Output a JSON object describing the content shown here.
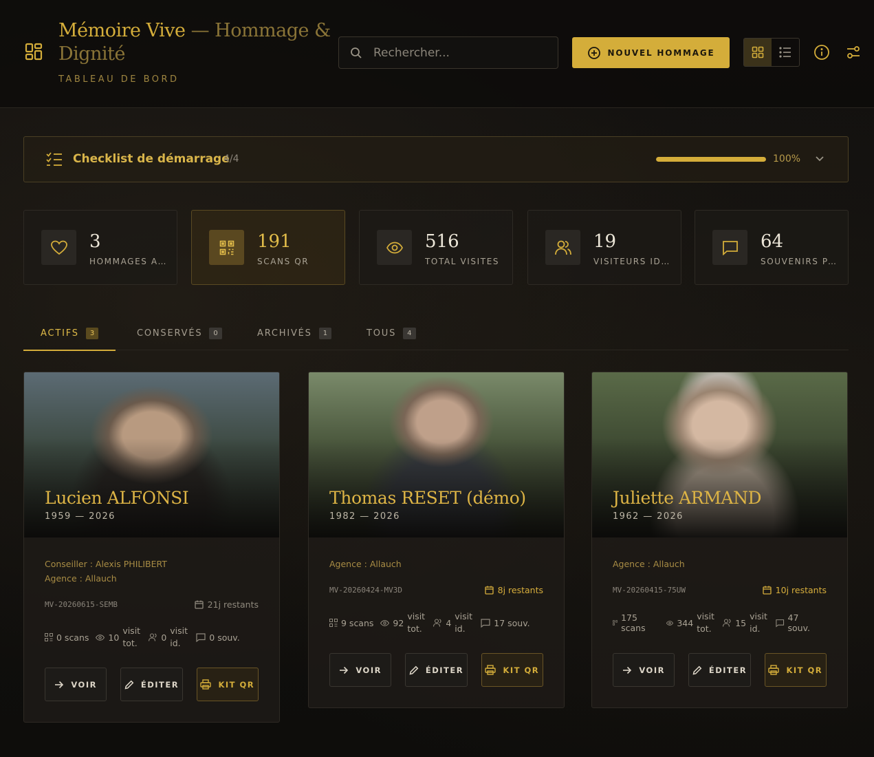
{
  "header": {
    "title_main": "Mémoire Vive",
    "title_rest": " — Hommage & Dignité",
    "subtitle": "TABLEAU DE BORD",
    "search_placeholder": "Rechercher...",
    "new_button_label": "NOUVEL HOMMAGE",
    "view_mode": "grid"
  },
  "checklist": {
    "title": "Checklist de démarrage",
    "count": "4/4",
    "progress_value": 1.0,
    "progress_label": "100%"
  },
  "stats": [
    {
      "icon": "heart-icon",
      "value": "3",
      "label": "HOMMAGES ACTIFS",
      "highlight": false
    },
    {
      "icon": "qr-code-icon",
      "value": "191",
      "label": "SCANS QR",
      "highlight": true
    },
    {
      "icon": "eye-icon",
      "value": "516",
      "label": "TOTAL VISITES",
      "highlight": false
    },
    {
      "icon": "users-icon",
      "value": "19",
      "label": "VISITEURS IDENTIFIÉS",
      "highlight": false
    },
    {
      "icon": "message-icon",
      "value": "64",
      "label": "SOUVENIRS PARTAGÉS",
      "highlight": false
    }
  ],
  "tabs": [
    {
      "label": "ACTIFS",
      "count": "3",
      "active": true
    },
    {
      "label": "CONSERVÉS",
      "count": "0",
      "active": false
    },
    {
      "label": "ARCHIVÉS",
      "count": "1",
      "active": false
    },
    {
      "label": "TOUS",
      "count": "4",
      "active": false
    }
  ],
  "cards": [
    {
      "name": "Lucien ALFONSI",
      "years": "1959 — 2026",
      "conseiller": "Conseiller : Alexis PHILIBERT",
      "agence": "Agence : Allauch",
      "code": "MV-20260615-SEMB",
      "remaining": "21j restants",
      "remaining_warn": false,
      "scans": "0 scans",
      "visits_total_num": "10",
      "visits_total_lbl": "visit tot.",
      "visits_id_num": "0",
      "visits_id_lbl": "visit id.",
      "souv": "0 souv."
    },
    {
      "name": "Thomas RESET (démo)",
      "years": "1982 — 2026",
      "conseiller": "",
      "agence": "Agence : Allauch",
      "code": "MV-20260424-MV3D",
      "remaining": "8j restants",
      "remaining_warn": true,
      "scans": "9 scans",
      "visits_total_num": "92",
      "visits_total_lbl": "visit tot.",
      "visits_id_num": "4",
      "visits_id_lbl": "visit id.",
      "souv": "17 souv."
    },
    {
      "name": "Juliette ARMAND",
      "years": "1962 — 2026",
      "conseiller": "",
      "agence": "Agence : Allauch",
      "code": "MV-20260415-75UW",
      "remaining": "10j restants",
      "remaining_warn": true,
      "scans": "175 scans",
      "visits_total_num": "344",
      "visits_total_lbl": "visit tot.",
      "visits_id_num": "15",
      "visits_id_lbl": "visit id.",
      "souv": "47 souv."
    }
  ],
  "card_actions": {
    "view": "VOIR",
    "edit": "ÉDITER",
    "qr": "KIT QR"
  },
  "colors": {
    "accent": "#d4ad3a",
    "background": "#0f0e0c",
    "card": "#1e1b17"
  }
}
